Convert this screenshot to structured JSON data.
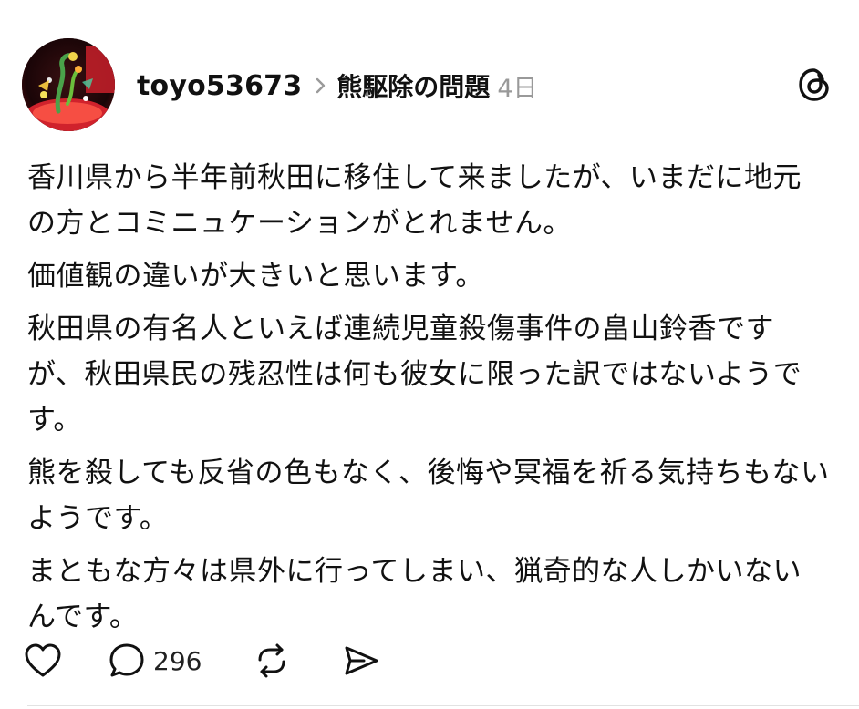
{
  "post": {
    "username": "toyo53673",
    "topic": "熊駆除の問題",
    "age": "4日",
    "paragraphs": [
      "香川県から半年前秋田に移住して来ましたが、いまだに地元の方とコミニュケーションがとれません。",
      "価値観の違いが大きいと思います。",
      "秋田県の有名人といえば連続児童殺傷事件の畠山鈴香ですが、秋田県民の残忍性は何も彼女に限った訳ではないようです。",
      "熊を殺しても反省の色もなく、後悔や冥福を祈る気持ちもないようです。",
      "まともな方々は県外に行ってしまい、猟奇的な人しかいないんです。"
    ],
    "actions": {
      "like_icon": "heart-icon",
      "comment_icon": "comment-bubble-icon",
      "comment_count": "296",
      "repost_icon": "repost-icon",
      "share_icon": "send-icon"
    }
  },
  "app": {
    "logo_icon": "threads-logo-icon"
  },
  "colors": {
    "text": "#111111",
    "muted": "#999999",
    "divider": "#e2e2e2"
  }
}
